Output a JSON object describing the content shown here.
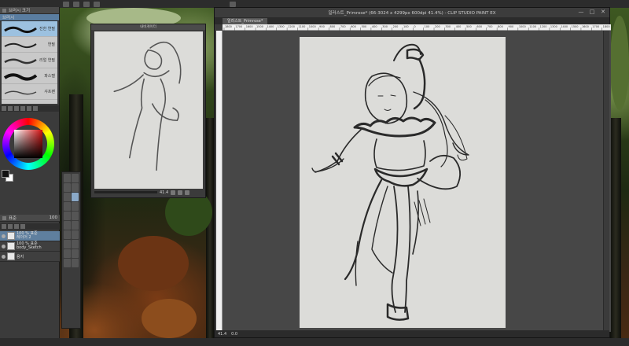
{
  "window": {
    "title": "일러스트_Primrose* (66-3024 x 4299px 600dpi 41.4%) - CLIP STUDIO PAINT EX",
    "tab_label": "일러스트_Primrose*",
    "controls": [
      "—",
      "□",
      "✕"
    ],
    "zoom": "41.4"
  },
  "ruler": {
    "ticks": [
      "1800",
      "1700",
      "1600",
      "1500",
      "1400",
      "1300",
      "1200",
      "1100",
      "1000",
      "900",
      "800",
      "700",
      "600",
      "500",
      "400",
      "300",
      "200",
      "100",
      "0",
      "100",
      "200",
      "300",
      "400",
      "500",
      "600",
      "700",
      "800",
      "900",
      "1000",
      "1100",
      "1200",
      "1300",
      "1400",
      "1500",
      "1600",
      "1700",
      "1800"
    ]
  },
  "brush_panel": {
    "tab_label": "브러시",
    "subtab_label": "브러시 크기",
    "items": [
      {
        "name": "진한 연필"
      },
      {
        "name": "연필"
      },
      {
        "name": "리얼 연필"
      },
      {
        "name": "파스텔"
      },
      {
        "name": "샤프펜"
      }
    ]
  },
  "navigator": {
    "title": "내비게이터",
    "zoom": "41.4",
    "angle": "0.0"
  },
  "layer_panel": {
    "blend_mode": "표준",
    "opacity": "100",
    "layers": [
      {
        "name": "100 % 표준",
        "sub": "레이어 2",
        "selected": true
      },
      {
        "name": "100 % 표준",
        "sub": "body_Sketch",
        "selected": false
      },
      {
        "name": "용지",
        "sub": "",
        "selected": false
      }
    ]
  },
  "colors": {
    "main": "#111111",
    "sub": "#ffffff",
    "accent": "#5f7f9e"
  }
}
